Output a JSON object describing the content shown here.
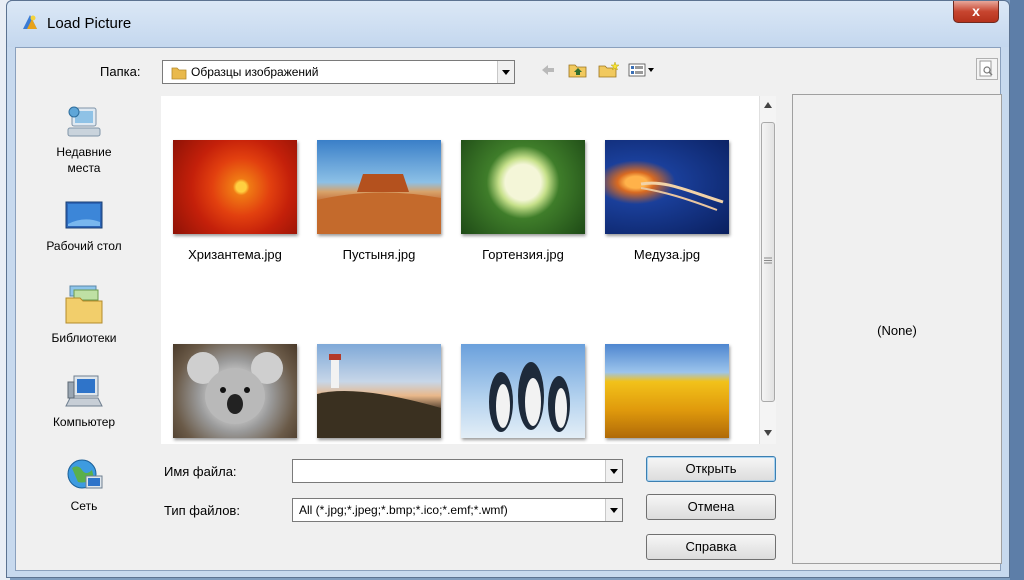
{
  "window": {
    "title": "Load Picture",
    "close_label": "x"
  },
  "folder": {
    "label": "Папка:",
    "value": "Образцы изображений"
  },
  "places": [
    {
      "label_line1": "Недавние",
      "label_line2": "места",
      "icon": "recent-places-icon"
    },
    {
      "label_line1": "Рабочий стол",
      "label_line2": "",
      "icon": "desktop-icon"
    },
    {
      "label_line1": "Библиотеки",
      "label_line2": "",
      "icon": "libraries-icon"
    },
    {
      "label_line1": "Компьютер",
      "label_line2": "",
      "icon": "computer-icon"
    },
    {
      "label_line1": "Сеть",
      "label_line2": "",
      "icon": "network-icon"
    }
  ],
  "files": [
    {
      "name": "Хризантема.jpg"
    },
    {
      "name": "Пустыня.jpg"
    },
    {
      "name": "Гортензия.jpg"
    },
    {
      "name": "Медуза.jpg"
    },
    {
      "name": ""
    },
    {
      "name": ""
    },
    {
      "name": ""
    },
    {
      "name": ""
    }
  ],
  "filename": {
    "label": "Имя файла:",
    "value": ""
  },
  "filetype": {
    "label": "Тип файлов:",
    "value": "All (*.jpg;*.jpeg;*.bmp;*.ico;*.emf;*.wmf)"
  },
  "buttons": {
    "open": "Открыть",
    "cancel": "Отмена",
    "help": "Справка"
  },
  "preview": {
    "text": "(None)"
  }
}
